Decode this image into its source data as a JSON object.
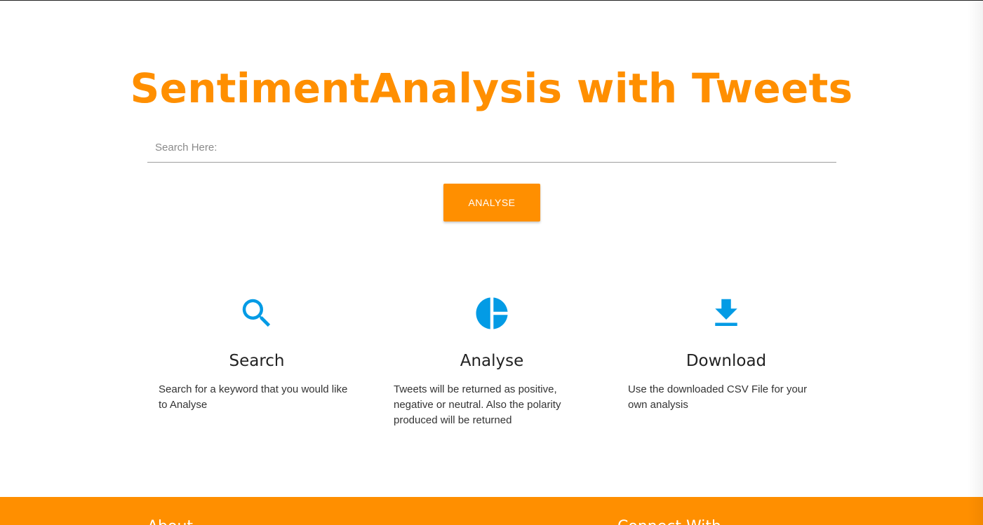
{
  "hero": {
    "title": "SentimentAnalysis with Tweets"
  },
  "search": {
    "placeholder": "Search Here:",
    "value": ""
  },
  "analyse_button": {
    "label": "ANALYSE"
  },
  "features": [
    {
      "icon": "search-icon",
      "title": "Search",
      "description": "Search for a keyword that you would like to Analyse"
    },
    {
      "icon": "pie-chart-icon",
      "title": "Analyse",
      "description": "Tweets will be returned as positive, negative or neutral. Also the polarity produced will be returned"
    },
    {
      "icon": "download-icon",
      "title": "Download",
      "description": "Use the downloaded CSV File for your own analysis"
    }
  ],
  "footer": {
    "about_heading": "About",
    "connect_heading": "Connect With"
  },
  "colors": {
    "accent": "#ff8f00",
    "icon": "#039be5",
    "footer_bg": "#ff8f00"
  }
}
